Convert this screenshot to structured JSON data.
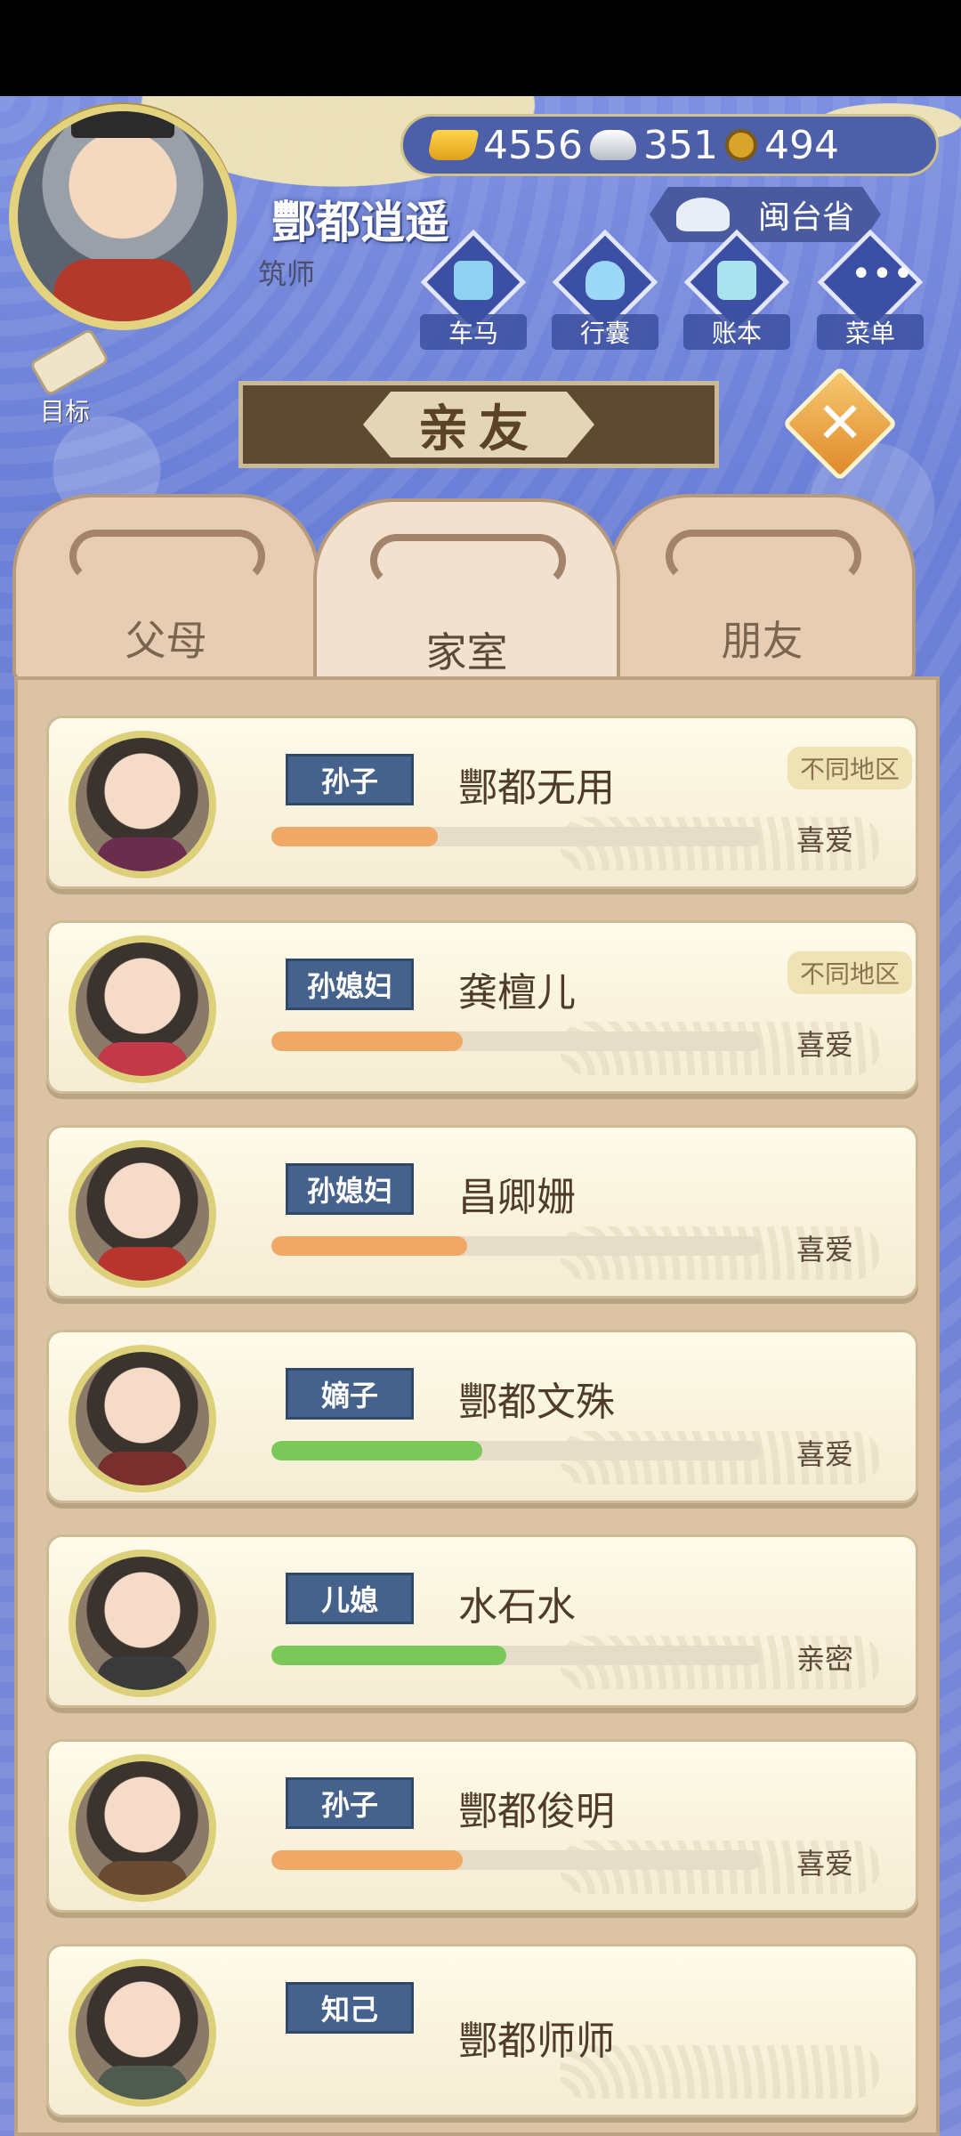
{
  "player": {
    "name": "酆都逍遥",
    "title": "筑师"
  },
  "currency": {
    "gold": "4556",
    "silver": "351",
    "copper": "494"
  },
  "location": {
    "province": "闽台省"
  },
  "menu": [
    {
      "label": "车马",
      "icon": "carriage-icon"
    },
    {
      "label": "行囊",
      "icon": "bag-icon"
    },
    {
      "label": "账本",
      "icon": "ledger-icon"
    },
    {
      "label": "菜单",
      "icon": "more-icon"
    }
  ],
  "goal": {
    "label": "目标"
  },
  "title": "亲友",
  "tabs": [
    {
      "label": "父母"
    },
    {
      "label": "家室"
    },
    {
      "label": "朋友"
    }
  ],
  "colors": {
    "accent_orange": "#f0a866",
    "accent_green": "#7bc85a",
    "relation_badge": "#45628c",
    "background": "#6f7fcf"
  },
  "relatives": [
    {
      "relation": "孙子",
      "name": "酆都无用",
      "region": "不同地区",
      "status": "喜爱",
      "affection": 0.34,
      "bar_color": "orange"
    },
    {
      "relation": "孙媳妇",
      "name": "龚檀儿",
      "region": "不同地区",
      "status": "喜爱",
      "affection": 0.39,
      "bar_color": "orange"
    },
    {
      "relation": "孙媳妇",
      "name": "昌卿姗",
      "region": "",
      "status": "喜爱",
      "affection": 0.4,
      "bar_color": "orange"
    },
    {
      "relation": "嫡子",
      "name": "酆都文殊",
      "region": "",
      "status": "喜爱",
      "affection": 0.43,
      "bar_color": "green"
    },
    {
      "relation": "儿媳",
      "name": "水石水",
      "region": "",
      "status": "亲密",
      "affection": 0.48,
      "bar_color": "green"
    },
    {
      "relation": "孙子",
      "name": "酆都俊明",
      "region": "",
      "status": "喜爱",
      "affection": 0.39,
      "bar_color": "orange"
    },
    {
      "relation": "知己",
      "name": "酆都师师",
      "region": "",
      "status": "",
      "affection": null,
      "bar_color": ""
    }
  ]
}
